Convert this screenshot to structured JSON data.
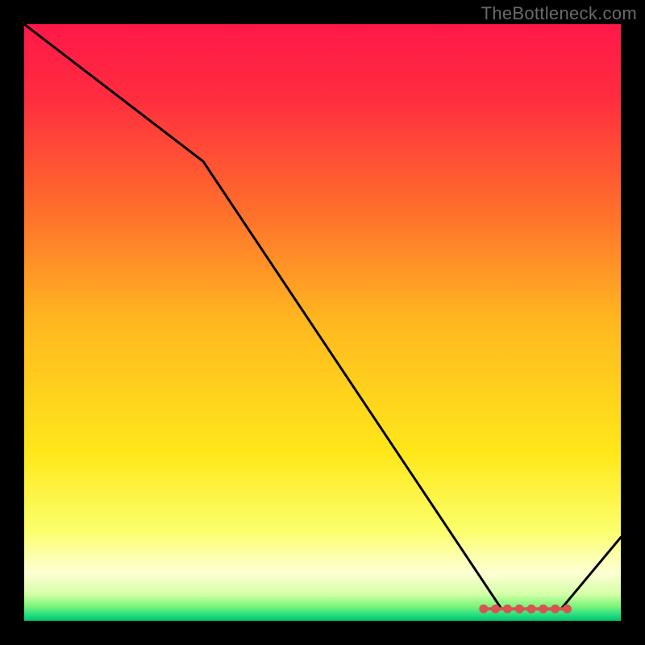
{
  "watermark": "TheBottleneck.com",
  "chart_data": {
    "type": "line",
    "title": "",
    "xlabel": "",
    "ylabel": "",
    "xlim": [
      0,
      100
    ],
    "ylim": [
      0,
      100
    ],
    "grid": false,
    "legend": false,
    "series": [
      {
        "name": "curve",
        "x": [
          0,
          30,
          80,
          90,
          100
        ],
        "y": [
          100,
          77,
          2,
          2,
          14
        ]
      }
    ],
    "markers": {
      "x": [
        77,
        79,
        81,
        83,
        85,
        87,
        89,
        91
      ],
      "y": [
        2,
        2,
        2,
        2,
        2,
        2,
        2,
        2
      ],
      "color": "#d9534f"
    },
    "background_gradient": {
      "orientation": "vertical",
      "stops": [
        {
          "pos": 0.0,
          "color": "#ff1848"
        },
        {
          "pos": 0.12,
          "color": "#ff2c3f"
        },
        {
          "pos": 0.3,
          "color": "#ff6a2d"
        },
        {
          "pos": 0.5,
          "color": "#ffb81f"
        },
        {
          "pos": 0.72,
          "color": "#ffe81a"
        },
        {
          "pos": 0.85,
          "color": "#fbff6d"
        },
        {
          "pos": 0.92,
          "color": "#fdffd4"
        },
        {
          "pos": 0.955,
          "color": "#d5ffa8"
        },
        {
          "pos": 0.975,
          "color": "#7ff57a"
        },
        {
          "pos": 0.99,
          "color": "#26de81"
        },
        {
          "pos": 1.0,
          "color": "#00c46c"
        }
      ]
    }
  }
}
